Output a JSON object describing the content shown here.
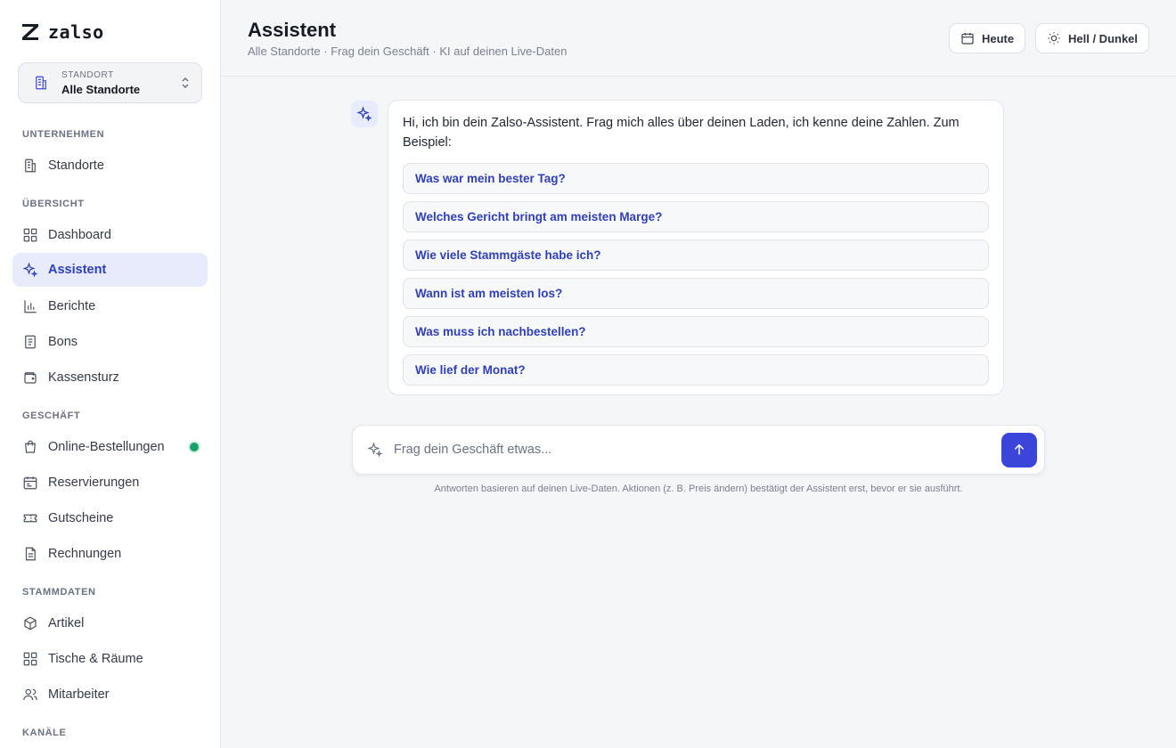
{
  "app": {
    "logo_text": "zalso"
  },
  "location": {
    "caption": "STANDORT",
    "value": "Alle Standorte"
  },
  "sidebar": {
    "sections": [
      {
        "label": "UNTERNEHMEN"
      },
      {
        "label": "ÜBERSICHT"
      },
      {
        "label": "GESCHÄFT"
      },
      {
        "label": "STAMMDATEN"
      },
      {
        "label": "KANÄLE"
      }
    ],
    "items": [
      {
        "label": "Standorte",
        "icon": "building-icon"
      },
      {
        "label": "Dashboard",
        "icon": "grid-icon"
      },
      {
        "label": "Assistent",
        "icon": "sparkles-icon",
        "active": true
      },
      {
        "label": "Berichte",
        "icon": "bar-chart-icon"
      },
      {
        "label": "Bons",
        "icon": "receipt-icon"
      },
      {
        "label": "Kassensturz",
        "icon": "wallet-icon"
      },
      {
        "label": "Online-Bestellungen",
        "icon": "shopping-bag-icon",
        "status": "online"
      },
      {
        "label": "Reservierungen",
        "icon": "calendar-list-icon"
      },
      {
        "label": "Gutscheine",
        "icon": "ticket-icon"
      },
      {
        "label": "Rechnungen",
        "icon": "document-icon"
      },
      {
        "label": "Artikel",
        "icon": "box-icon"
      },
      {
        "label": "Tische & Räume",
        "icon": "grid-icon"
      },
      {
        "label": "Mitarbeiter",
        "icon": "users-icon"
      }
    ]
  },
  "header": {
    "title": "Assistent",
    "subtitle": "Alle Standorte · Frag dein Geschäft · KI auf deinen Live-Daten",
    "today_label": "Heute",
    "theme_label": "Hell / Dunkel"
  },
  "chat": {
    "intro": "Hi, ich bin dein Zalso-Assistent. Frag mich alles über deinen Laden, ich kenne deine Zahlen. Zum Beispiel:",
    "suggestions": [
      "Was war mein bester Tag?",
      "Welches Gericht bringt am meisten Marge?",
      "Wie viele Stammgäste habe ich?",
      "Wann ist am meisten los?",
      "Was muss ich nachbestellen?",
      "Wie lief der Monat?"
    ]
  },
  "composer": {
    "placeholder": "Frag dein Geschäft etwas...",
    "value": "",
    "disclaimer": "Antworten basieren auf deinen Live-Daten. Aktionen (z. B. Preis ändern) bestätigt der Assistent erst, bevor er sie ausführt."
  },
  "colors": {
    "accent": "#3b45d9",
    "active_bg": "#e8ebfb",
    "online": "#19a06b"
  }
}
